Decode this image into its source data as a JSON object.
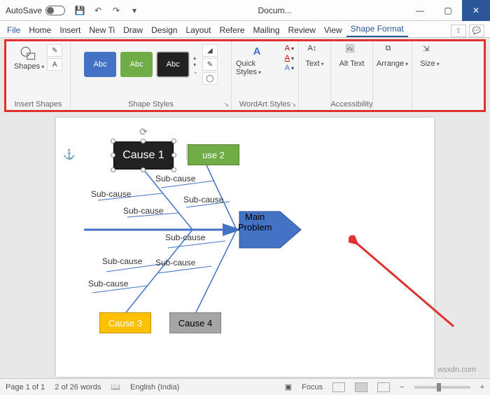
{
  "titlebar": {
    "autosave": "AutoSave",
    "doc_title": "Docum...",
    "min": "—",
    "max": "▢",
    "close": "✕"
  },
  "tabs": {
    "file": "File",
    "items": [
      "Home",
      "Insert",
      "New Ti",
      "Draw",
      "Design",
      "Layout",
      "Refere",
      "Mailing",
      "Review",
      "View"
    ],
    "active": "Shape Format"
  },
  "ribbon": {
    "insert_shapes": {
      "shapes": "Shapes",
      "group": "Insert Shapes"
    },
    "shape_styles": {
      "abc": "Abc",
      "group": "Shape Styles"
    },
    "quick_styles": "Quick Styles",
    "wordart_group": "WordArt Styles",
    "text_btn": "Text",
    "alt_text": "Alt Text",
    "accessibility_group": "Accessibility",
    "arrange": "Arrange",
    "size": "Size"
  },
  "diagram": {
    "cause1": "Cause 1",
    "cause2": "use 2",
    "cause3": "Cause 3",
    "cause4": "Cause 4",
    "main_problem_l1": "Main",
    "main_problem_l2": "Problem",
    "subcause": "Sub-cause"
  },
  "status": {
    "page": "Page 1 of 1",
    "words": "2 of 26 words",
    "lang": "English (India)",
    "focus": "Focus",
    "zoom_minus": "−",
    "zoom_plus": "+"
  },
  "watermark": "wsxdn.com"
}
